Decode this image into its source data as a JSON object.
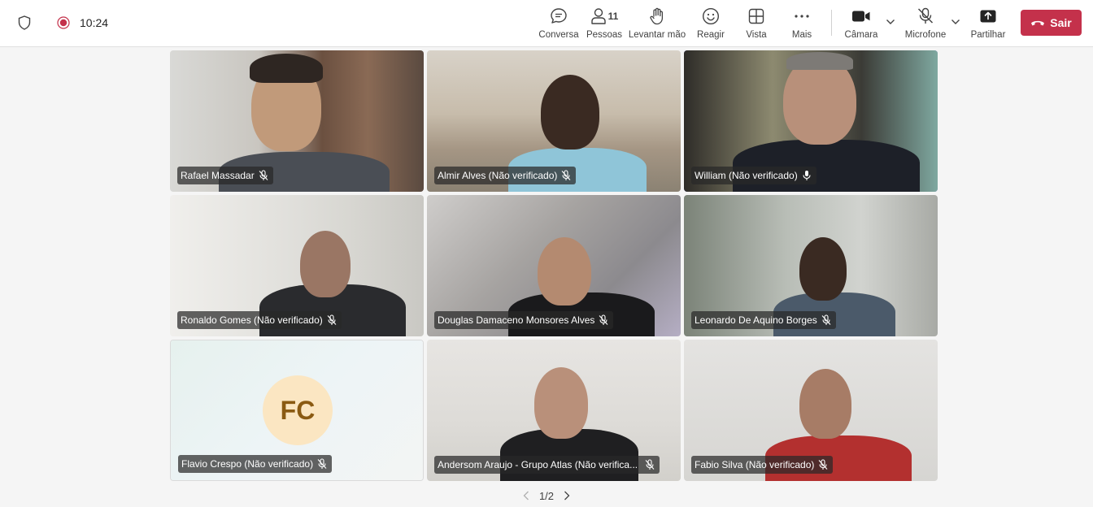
{
  "status": {
    "time": "10:24",
    "shield_icon": "shield-icon",
    "record_icon": "record-icon"
  },
  "toolbar": {
    "chat": "Conversa",
    "people": "Pessoas",
    "people_count": "11",
    "raise_hand": "Levantar mão",
    "react": "Reagir",
    "view": "Vista",
    "more": "Mais",
    "camera": "Câmara",
    "mic": "Microfone",
    "share": "Partilhar",
    "leave": "Sair"
  },
  "colors": {
    "leave": "#c4314b",
    "active_border": "#6b6ed3",
    "avatar_bg": "#fbe6c2",
    "avatar_text": "#8a5a12"
  },
  "participants": [
    {
      "name": "Rafael Massadar",
      "mic": "muted"
    },
    {
      "name": "Almir Alves (Não verificado)",
      "mic": "muted"
    },
    {
      "name": "William (Não verificado)",
      "mic": "speaking"
    },
    {
      "name": "Ronaldo Gomes (Não verificado)",
      "mic": "muted"
    },
    {
      "name": "Douglas Damaceno Monsores Alves",
      "mic": "muted"
    },
    {
      "name": "Leonardo De Aquino Borges",
      "mic": "muted"
    },
    {
      "name": "Flavio Crespo (Não verificado)",
      "mic": "muted",
      "initials": "FC"
    },
    {
      "name": "Andersom Araujo - Grupo Atlas (Não verifica...",
      "mic": "muted"
    },
    {
      "name": "Fabio Silva (Não verificado)",
      "mic": "muted"
    }
  ],
  "pager": {
    "label": "1/2"
  }
}
